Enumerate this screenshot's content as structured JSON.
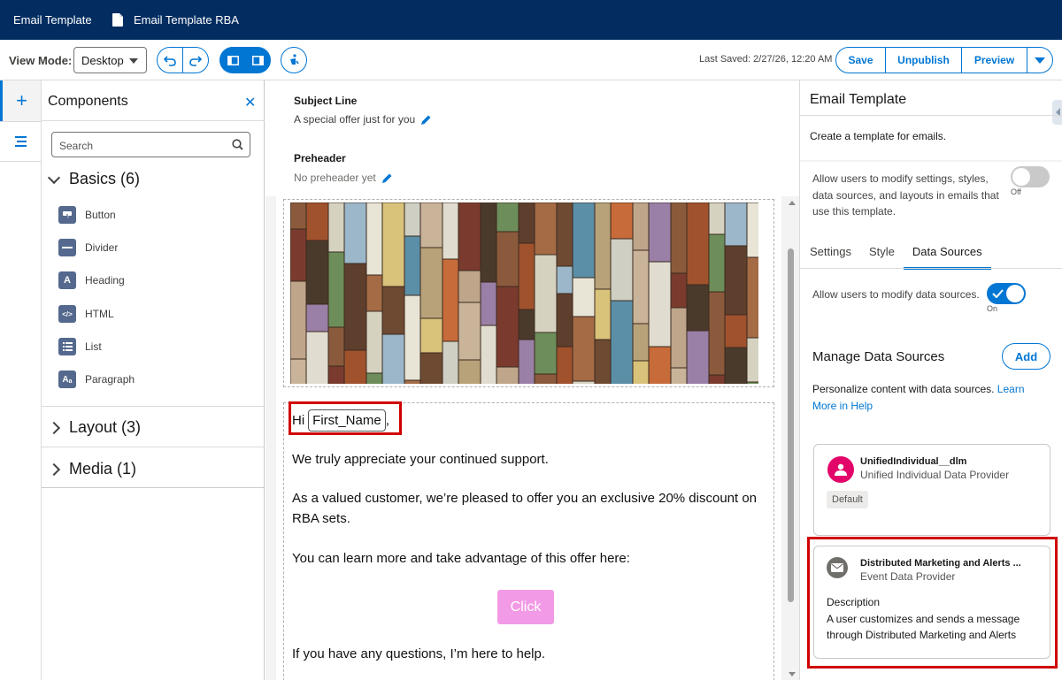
{
  "topbar": {
    "tab1": "Email Template",
    "tab2": "Email Template RBA"
  },
  "toolbar": {
    "view_mode_label": "View Mode:",
    "view_mode_value": "Desktop",
    "last_saved": "Last Saved: 2/27/26, 12:20 AM",
    "save": "Save",
    "unpublish": "Unpublish",
    "preview": "Preview"
  },
  "components": {
    "title": "Components",
    "search_placeholder": "Search",
    "basics": "Basics (6)",
    "items": [
      "Button",
      "Divider",
      "Heading",
      "HTML",
      "List",
      "Paragraph"
    ],
    "layout": "Layout (3)",
    "media": "Media (1)"
  },
  "canvas": {
    "subject_label": "Subject Line",
    "subject_value": "A special offer just for you",
    "preheader_label": "Preheader",
    "preheader_value": "No preheader yet",
    "greeting": "Hi",
    "merge_field": "First_Name",
    "greeting_end": ",",
    "p1": "We truly appreciate your continued support.",
    "p2a": "As a valued customer, we’re pleased to offer you an exclusive 20% discount on",
    "p2b": "RBA sets.",
    "p3": "You can learn more and take advantage of this offer here:",
    "button": "Click",
    "p4": "If you have any questions, I’m here to help."
  },
  "right": {
    "title": "Email Template",
    "subtitle": "Create a template for emails.",
    "allow_modify": "Allow users to modify settings, styles, data sources, and layouts in emails that use this template.",
    "toggle1_state": "Off",
    "tabs": [
      "Settings",
      "Style",
      "Data Sources"
    ],
    "allow_ds": "Allow users to modify data sources.",
    "toggle2_state": "On",
    "manage_title": "Manage Data Sources",
    "add": "Add",
    "personalize": "Personalize content with data sources.",
    "learn_more": "Learn More in Help",
    "card1_title": "UnifiedIndividual__dlm",
    "card1_sub": "Unified Individual Data Provider",
    "card1_badge": "Default",
    "card2_title": "Distributed Marketing and Alerts ...",
    "card2_sub": "Event Data Provider",
    "card2_desc_label": "Description",
    "card2_desc": "A user customizes and sends a message through Distributed Marketing and Alerts"
  },
  "colors": {
    "brand_bar": "#032d60",
    "accent": "#0176d3",
    "highlight": "#d00000",
    "button_pink": "#f29ae5"
  }
}
